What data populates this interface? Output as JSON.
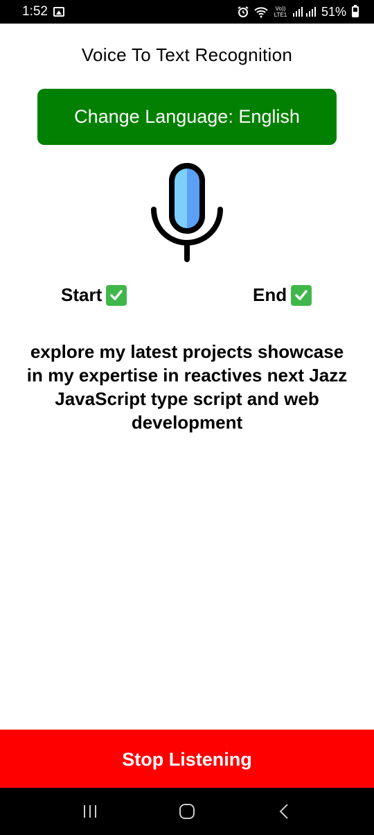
{
  "status_bar": {
    "time": "1:52",
    "network": "Vo)) LTE1",
    "battery": "51%"
  },
  "app": {
    "title": "Voice To Text Recognition",
    "language_button": "Change Language: English",
    "start_label": "Start",
    "end_label": "End",
    "transcript": "explore my latest projects showcase in my expertise in reactives next Jazz JavaScript type script and web development",
    "stop_button": "Stop Listening"
  },
  "colors": {
    "language_button_bg": "#028001",
    "stop_button_bg": "#fe0000",
    "mic_fill_light": "#7ecffa",
    "mic_fill_dark": "#5aa0f5",
    "check_green": "#40b74a"
  },
  "icons": {
    "gallery": "gallery-icon",
    "alarm": "alarm-icon",
    "wifi": "wifi-icon",
    "signal": "signal-icon",
    "battery": "battery-icon",
    "microphone": "microphone-icon",
    "check": "check-icon",
    "recents": "recents-icon",
    "home": "home-icon",
    "back": "back-icon"
  }
}
